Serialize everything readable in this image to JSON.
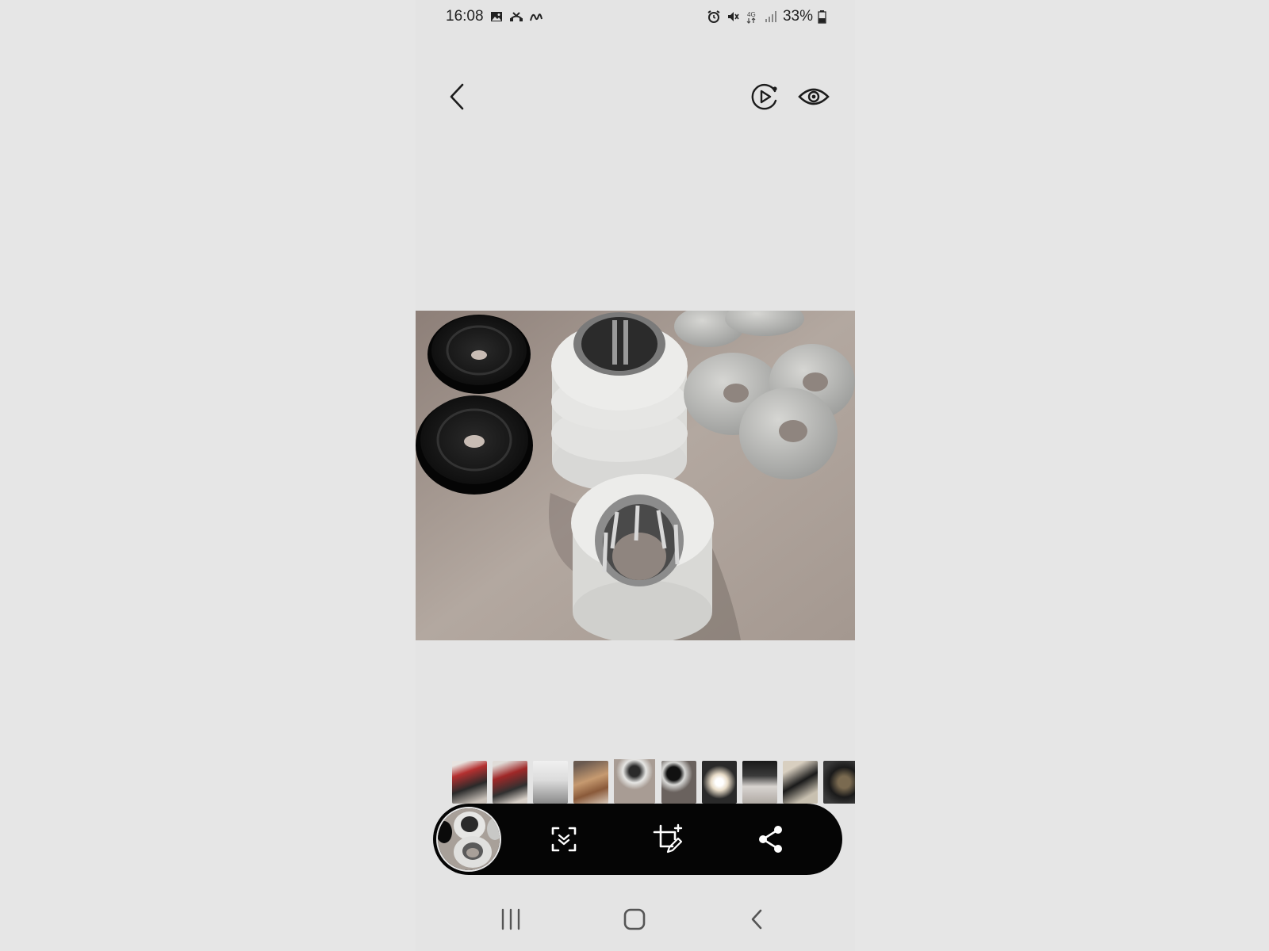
{
  "status_bar": {
    "time": "16:08",
    "battery": "33%",
    "network": "4G",
    "left_icons": [
      "gallery-notification-icon",
      "missed-call-icon",
      "signature-icon"
    ],
    "right_icons": [
      "alarm-icon",
      "mute-icon",
      "4g-data-icon",
      "signal-icon",
      "battery-icon"
    ]
  },
  "top_bar": {
    "icons": [
      "back-arrow-icon",
      "motion-photo-icon",
      "view-eye-icon"
    ]
  },
  "photo": {
    "subject": "photo-viewer-image"
  },
  "filmstrip": {
    "count": 10,
    "current_index": 4
  },
  "toolbar": {
    "icons": [
      "current-photo-thumbnail",
      "scan-document-icon",
      "edit-crop-icon",
      "share-icon"
    ],
    "background": "#050505"
  },
  "nav_bar": {
    "icons": [
      "recent-apps-icon",
      "home-icon",
      "back-icon"
    ]
  },
  "colors": {
    "background": "#e4e4e4",
    "toolbar": "#050505",
    "icon": "#1c1c1c"
  }
}
